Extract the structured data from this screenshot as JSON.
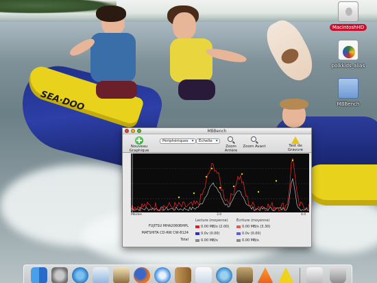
{
  "desktop": {
    "icons": [
      {
        "label": "MacintoshHD",
        "icon": "hard-drive-icon",
        "selected": true
      },
      {
        "label": "polkkids_alias",
        "icon": "document-alias-icon",
        "selected": false
      },
      {
        "label": "MBBench",
        "icon": "folder-icon",
        "selected": false
      }
    ]
  },
  "window": {
    "title": "MBBench",
    "toolbar": {
      "new_graph": "Nouveau Graphique",
      "peripherals_popup": "Périphériques",
      "scale_popup": "Échelle",
      "zoom_out": "Zoom Arrière",
      "zoom_in": "Zoom Avant",
      "burn_test": "Test de Gravure"
    },
    "chart": {
      "x_start_label": "Mbides",
      "x_mid_label": "3.0",
      "x_end_label": "4.0",
      "colors": {
        "red_series": "#ff2a2a",
        "gray_series": "#d8d8d8",
        "yellow_markers": "#e6d200",
        "background": "#0b0b0b"
      }
    },
    "table": {
      "headers": {
        "read": "Lecture (moyenne)",
        "write": "Écriture (moyenne)"
      },
      "rows": [
        {
          "device": "FUJITSU MHA2060BHPL",
          "read": "0.00 MB/s (2.00)",
          "write": "0.00 MB/s (3.30)",
          "read_color": "#e01e1e",
          "write_color": "#e05a5a",
          "read_level": 0.0,
          "write_level": 0.0
        },
        {
          "device": "MATSHITA CD-RW CW-8124",
          "read": "0.0v (0.00)",
          "write": "0.0v (0.00)",
          "read_color": "#2a2ad8",
          "write_color": "#5c5cf0",
          "read_level": 0.0,
          "write_level": 0.0
        },
        {
          "device": "Total",
          "read": "0.00 MB/s",
          "write": "0.00 MB/s",
          "read_color": "#8a8a8a",
          "write_color": "#8a8a8a",
          "read_level": 0.0,
          "write_level": 0.0
        }
      ]
    }
  },
  "dock": {
    "items": [
      "finder-icon",
      "system-preferences-icon",
      "itunes-icon",
      "mail-icon",
      "photo-icon",
      "firefox-icon",
      "safari-icon",
      "address-book-icon",
      "preview-icon",
      "camino-icon",
      "gimp-icon",
      "vlc-icon",
      "warning-icon",
      "documents-stack-icon",
      "trash-icon"
    ]
  }
}
